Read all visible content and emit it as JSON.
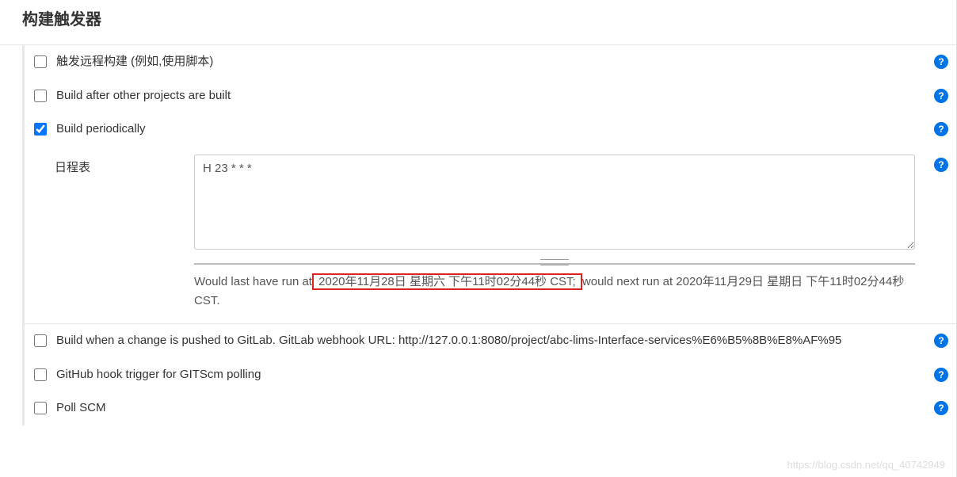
{
  "section": {
    "title": "构建触发器"
  },
  "triggers": {
    "remote": {
      "label": "触发远程构建 (例如,使用脚本)",
      "checked": false
    },
    "buildAfter": {
      "label": "Build after other projects are built",
      "checked": false
    },
    "periodically": {
      "label": "Build periodically",
      "checked": true
    },
    "gitlab": {
      "label": "Build when a change is pushed to GitLab. GitLab webhook URL: http://127.0.0.1:8080/project/abc-lims-Interface-services%E6%B5%8B%E8%AF%95",
      "checked": false
    },
    "github": {
      "label": "GitHub hook trigger for GITScm polling",
      "checked": false
    },
    "pollscm": {
      "label": "Poll SCM",
      "checked": false
    }
  },
  "schedule": {
    "label": "日程表",
    "value": "H 23 * * *",
    "info_pre": "Would last have run at",
    "info_highlight": " 2020年11月28日 星期六 下午11时02分44秒 CST; ",
    "info_post": "would next run at 2020年11月29日 星期日 下午11时02分44秒 CST."
  },
  "help": {
    "glyph": "?"
  },
  "watermark": "https://blog.csdn.net/qq_40742949"
}
